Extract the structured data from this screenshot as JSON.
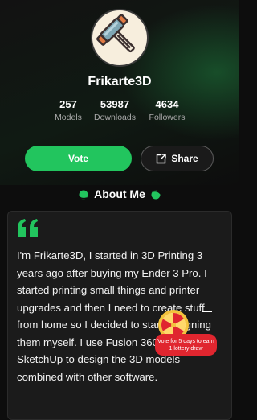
{
  "profile": {
    "name": "Frikarte3D",
    "avatar_icon": "hammer-icon"
  },
  "stats": [
    {
      "value": "257",
      "label": "Models"
    },
    {
      "value": "53987",
      "label": "Downloads"
    },
    {
      "value": "4634",
      "label": "Followers"
    }
  ],
  "actions": {
    "vote_label": "Vote",
    "share_label": "Share",
    "share_icon": "share-icon"
  },
  "about": {
    "title": "About Me",
    "text": "I'm Frikarte3D, I started in 3D Printing 3 years ago after buying my Ender 3 Pro. I started printing small things and printer upgrades and then I need to create stuff from home so I decided to start designing them myself. I use Fusion 360 and SketchUp to design the 3D models combined with other software."
  },
  "promo": {
    "text": "Vote for 5 days to earn 1 lottery draw",
    "wheel_icon": "prize-wheel-icon",
    "dismiss_icon": "minus-icon"
  },
  "colors": {
    "accent": "#22c55e",
    "promo": "#e0262f",
    "background": "#0d0d0d"
  }
}
